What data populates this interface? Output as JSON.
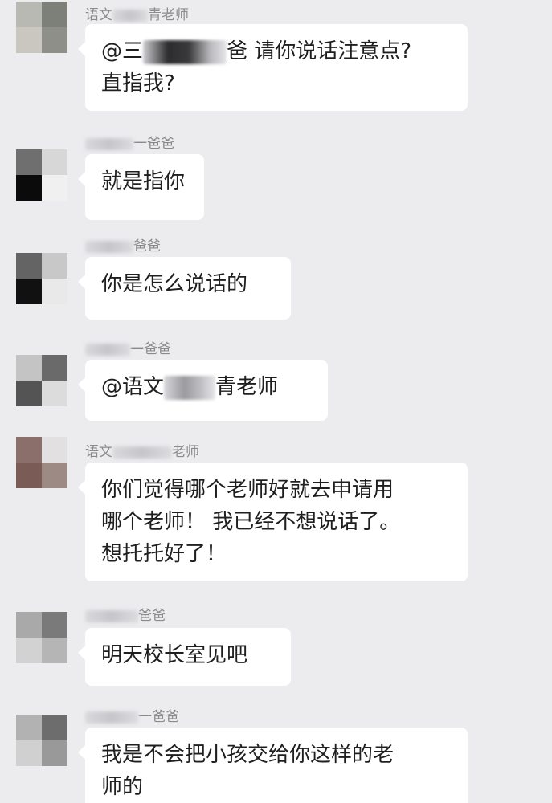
{
  "messages": [
    {
      "sender_prefix": "语文",
      "sender_suffix": "青老师",
      "text_before": "@三",
      "text_after": "爸 请你说话注意点?",
      "text_line2": "直指我?"
    },
    {
      "sender_prefix": "",
      "sender_suffix": "一爸爸",
      "text": "就是指你"
    },
    {
      "sender_prefix": "",
      "sender_suffix": "爸爸",
      "text": "你是怎么说话的"
    },
    {
      "sender_prefix": "",
      "sender_suffix": "一爸爸",
      "text_before": "@语文",
      "text_after": "青老师"
    },
    {
      "sender_prefix": "语文",
      "sender_suffix": "老师",
      "lines": [
        "你们觉得哪个老师好就去申请用",
        "哪个老师！ 我已经不想说话了。",
        "想托托好了！"
      ]
    },
    {
      "sender_prefix": "",
      "sender_suffix": "爸爸",
      "text": "明天校长室见吧"
    },
    {
      "sender_prefix": "",
      "sender_suffix": "一爸爸",
      "lines": [
        "我是不会把小孩交给你这样的老",
        "师的"
      ]
    }
  ],
  "colors": {
    "background": "#ececef",
    "bubble": "#ffffff",
    "sender": "#8a8a8a",
    "text": "#1f1f1f"
  }
}
